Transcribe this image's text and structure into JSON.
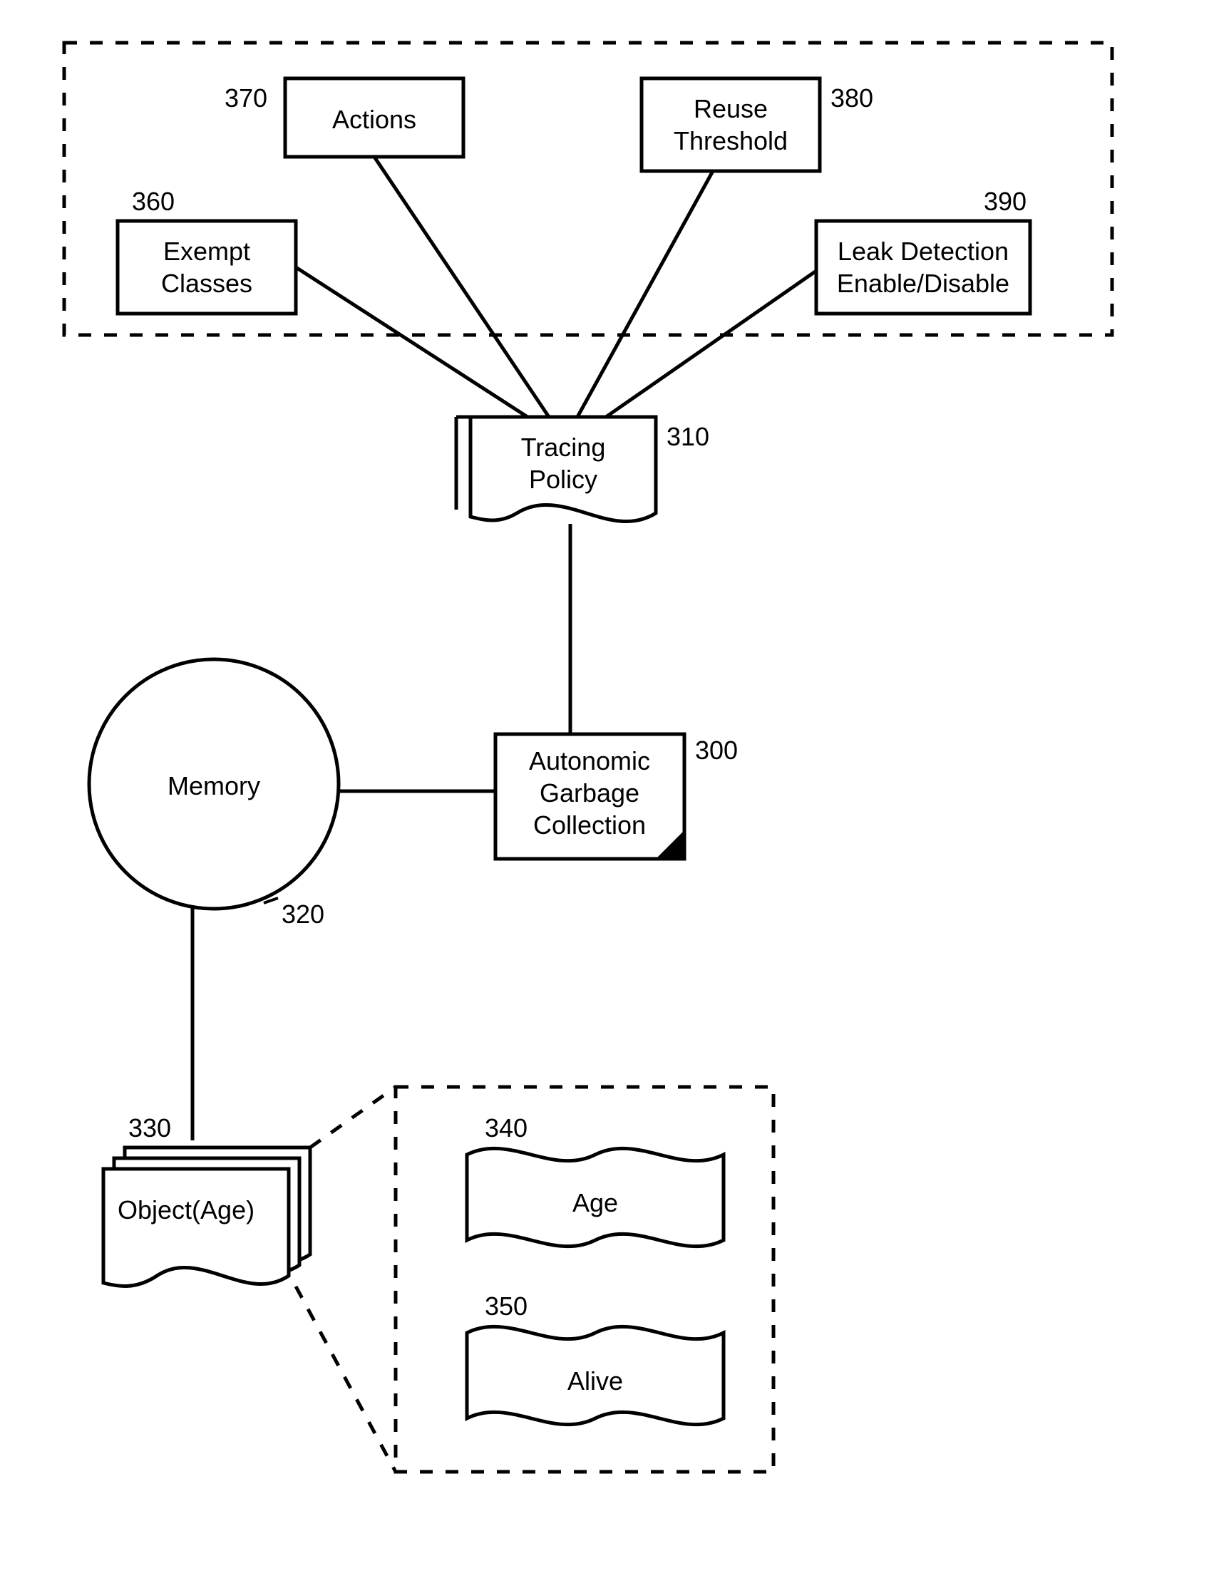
{
  "nodes": {
    "actions": {
      "label": "Actions",
      "ref": "370"
    },
    "reuse": {
      "label_l1": "Reuse",
      "label_l2": "Threshold",
      "ref": "380"
    },
    "exempt": {
      "label_l1": "Exempt",
      "label_l2": "Classes",
      "ref": "360"
    },
    "leak": {
      "label_l1": "Leak Detection",
      "label_l2": "Enable/Disable",
      "ref": "390"
    },
    "tracing": {
      "label_l1": "Tracing",
      "label_l2": "Policy",
      "ref": "310"
    },
    "gc": {
      "label_l1": "Autonomic",
      "label_l2": "Garbage",
      "label_l3": "Collection",
      "ref": "300"
    },
    "memory": {
      "label": "Memory",
      "ref": "320"
    },
    "object": {
      "label": "Object(Age)",
      "ref": "330"
    },
    "age": {
      "label": "Age",
      "ref": "340"
    },
    "alive": {
      "label": "Alive",
      "ref": "350"
    }
  }
}
